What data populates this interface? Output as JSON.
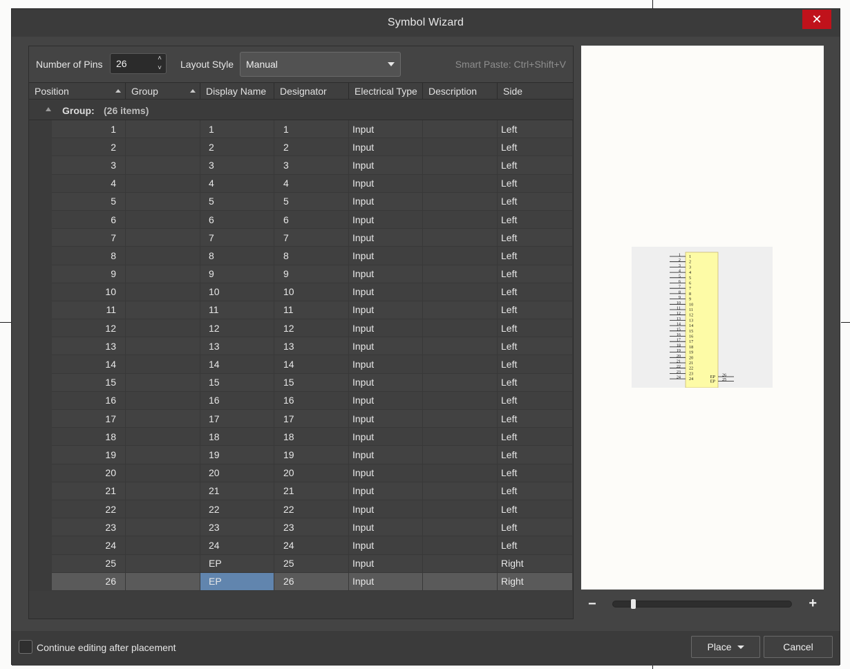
{
  "dialog": {
    "title": "Symbol Wizard",
    "close_icon": "close-icon"
  },
  "toolbar": {
    "pins_label": "Number of Pins",
    "pins_value": "26",
    "layout_label": "Layout Style",
    "layout_value": "Manual",
    "smart_paste": "Smart Paste: Ctrl+Shift+V"
  },
  "table": {
    "columns": [
      "Position",
      "Group",
      "Display Name",
      "Designator",
      "Electrical Type",
      "Description",
      "Side"
    ],
    "group_label": "Group:",
    "group_count": "(26 items)",
    "rows": [
      {
        "position": "1",
        "group": "",
        "display": "1",
        "designator": "1",
        "electrical": "Input",
        "description": "",
        "side": "Left"
      },
      {
        "position": "2",
        "group": "",
        "display": "2",
        "designator": "2",
        "electrical": "Input",
        "description": "",
        "side": "Left"
      },
      {
        "position": "3",
        "group": "",
        "display": "3",
        "designator": "3",
        "electrical": "Input",
        "description": "",
        "side": "Left"
      },
      {
        "position": "4",
        "group": "",
        "display": "4",
        "designator": "4",
        "electrical": "Input",
        "description": "",
        "side": "Left"
      },
      {
        "position": "5",
        "group": "",
        "display": "5",
        "designator": "5",
        "electrical": "Input",
        "description": "",
        "side": "Left"
      },
      {
        "position": "6",
        "group": "",
        "display": "6",
        "designator": "6",
        "electrical": "Input",
        "description": "",
        "side": "Left"
      },
      {
        "position": "7",
        "group": "",
        "display": "7",
        "designator": "7",
        "electrical": "Input",
        "description": "",
        "side": "Left"
      },
      {
        "position": "8",
        "group": "",
        "display": "8",
        "designator": "8",
        "electrical": "Input",
        "description": "",
        "side": "Left"
      },
      {
        "position": "9",
        "group": "",
        "display": "9",
        "designator": "9",
        "electrical": "Input",
        "description": "",
        "side": "Left"
      },
      {
        "position": "10",
        "group": "",
        "display": "10",
        "designator": "10",
        "electrical": "Input",
        "description": "",
        "side": "Left"
      },
      {
        "position": "11",
        "group": "",
        "display": "11",
        "designator": "11",
        "electrical": "Input",
        "description": "",
        "side": "Left"
      },
      {
        "position": "12",
        "group": "",
        "display": "12",
        "designator": "12",
        "electrical": "Input",
        "description": "",
        "side": "Left"
      },
      {
        "position": "13",
        "group": "",
        "display": "13",
        "designator": "13",
        "electrical": "Input",
        "description": "",
        "side": "Left"
      },
      {
        "position": "14",
        "group": "",
        "display": "14",
        "designator": "14",
        "electrical": "Input",
        "description": "",
        "side": "Left"
      },
      {
        "position": "15",
        "group": "",
        "display": "15",
        "designator": "15",
        "electrical": "Input",
        "description": "",
        "side": "Left"
      },
      {
        "position": "16",
        "group": "",
        "display": "16",
        "designator": "16",
        "electrical": "Input",
        "description": "",
        "side": "Left"
      },
      {
        "position": "17",
        "group": "",
        "display": "17",
        "designator": "17",
        "electrical": "Input",
        "description": "",
        "side": "Left"
      },
      {
        "position": "18",
        "group": "",
        "display": "18",
        "designator": "18",
        "electrical": "Input",
        "description": "",
        "side": "Left"
      },
      {
        "position": "19",
        "group": "",
        "display": "19",
        "designator": "19",
        "electrical": "Input",
        "description": "",
        "side": "Left"
      },
      {
        "position": "20",
        "group": "",
        "display": "20",
        "designator": "20",
        "electrical": "Input",
        "description": "",
        "side": "Left"
      },
      {
        "position": "21",
        "group": "",
        "display": "21",
        "designator": "21",
        "electrical": "Input",
        "description": "",
        "side": "Left"
      },
      {
        "position": "22",
        "group": "",
        "display": "22",
        "designator": "22",
        "electrical": "Input",
        "description": "",
        "side": "Left"
      },
      {
        "position": "23",
        "group": "",
        "display": "23",
        "designator": "23",
        "electrical": "Input",
        "description": "",
        "side": "Left"
      },
      {
        "position": "24",
        "group": "",
        "display": "24",
        "designator": "24",
        "electrical": "Input",
        "description": "",
        "side": "Left"
      },
      {
        "position": "25",
        "group": "",
        "display": "EP",
        "designator": "25",
        "electrical": "Input",
        "description": "",
        "side": "Right"
      },
      {
        "position": "26",
        "group": "",
        "display": "EP",
        "designator": "26",
        "electrical": "Input",
        "description": "",
        "side": "Right"
      }
    ],
    "selected_row": 25
  },
  "preview": {
    "left_pins": [
      "1",
      "2",
      "3",
      "4",
      "5",
      "6",
      "7",
      "8",
      "9",
      "10",
      "11",
      "12",
      "13",
      "14",
      "15",
      "16",
      "17",
      "18",
      "19",
      "20",
      "21",
      "22",
      "23",
      "24"
    ],
    "right_pins": [
      {
        "name": "EP",
        "number": "26"
      },
      {
        "name": "EP",
        "number": "25"
      }
    ],
    "body_color": "#fdfba6",
    "zoom_level": 0.1
  },
  "footer": {
    "continue_label": "Continue editing after placement",
    "continue_checked": false,
    "place_label": "Place",
    "cancel_label": "Cancel"
  },
  "colors": {
    "close": "#c0121b",
    "selection": "#6185ae"
  }
}
